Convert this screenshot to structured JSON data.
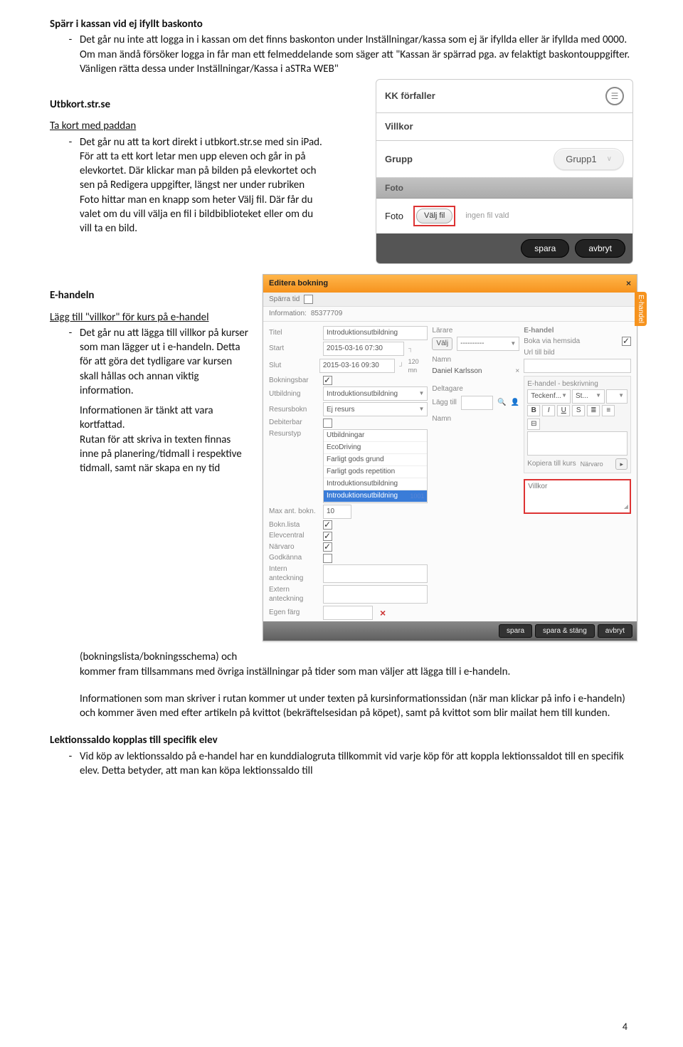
{
  "doc": {
    "section1": {
      "title": "Spärr i kassan vid ej ifyllt baskonto",
      "body": "Det går nu inte att logga in i kassan om det finns baskonton under Inställningar/kassa som ej är ifyllda eller är ifyllda med 0000.\nOm man ändå försöker logga in får man ett felmeddelande som säger att \"Kassan är spärrad pga. av felaktigt baskontouppgifter. Vänligen rätta dessa under Inställningar/Kassa i aSTRa WEB\""
    },
    "section2": {
      "title": "Utbkort.str.se",
      "sub": "Ta kort med paddan",
      "body": "Det går nu att ta kort direkt i utbkort.str.se med sin iPad. För att ta ett kort letar men upp eleven och går in på elevkortet. Där klickar man på bilden på elevkortet och sen på Redigera uppgifter, längst ner under rubriken Foto hittar man en knapp som heter Välj fil. Där får du valet om du vill välja en fil i bildbiblioteket eller om du vill ta en bild."
    },
    "section3": {
      "title": "E-handeln",
      "sub1": "Lägg till \"villkor\" för kurs på e-handel",
      "body1": "Det går nu att lägga till villkor på kurser som man lägger ut i e-handeln. Detta för att göra det tydligare var kursen skall hållas och annan viktig information.",
      "body2": "Informationen är tänkt att vara kortfattad.\nRutan för att skriva in texten finnas inne på planering/tidmall i respektive tidmall, samt när skapa en ny tid (bokningslista/bokningsschema) och kommer fram tillsammans med övriga inställningar på tider som man väljer att lägga till i e-handeln.",
      "body3": "Informationen som man skriver i rutan kommer ut under texten på kursinformationssidan (när man klickar på info i e-handeln) och kommer även med efter artikeln på kvittot (bekräftelsesidan på köpet), samt på kvittot som blir mailat hem till kunden.",
      "sub2": "Lektionssaldo kopplas till specifik elev",
      "body4": "Vid köp av lektionssaldo på e-handel har en kunddialogruta tillkommit vid varje köp för att koppla lektionssaldot till en specifik elev. Detta betyder, att man kan köpa lektionssaldo till"
    },
    "page_number": "4"
  },
  "ipad": {
    "row1_label": "KK förfaller",
    "row2_label": "Villkor",
    "row3_label": "Grupp",
    "row3_value": "Grupp1",
    "foto_header": "Foto",
    "foto_label": "Foto",
    "valj_fil": "Välj fil",
    "ingen_fil": "ingen fil vald",
    "spara": "spara",
    "avbryt": "avbryt"
  },
  "book": {
    "title": "Editera bokning",
    "sparra": "Spärra tid",
    "info_label": "Information:",
    "info_id": "85377709",
    "ehandel_tab": "E-handel",
    "col1": {
      "titel_l": "Titel",
      "titel_v": "Introduktionsutbildning",
      "start_l": "Start",
      "start_v": "2015-03-16  07:30",
      "slut_l": "Slut",
      "slut_v": "2015-03-16  09:30",
      "min_suffix": "120  mn",
      "bok_l": "Bokningsbar",
      "utb_l": "Utbildning",
      "utb_v": "Introduktionsutbildning",
      "reb_l": "Resursbokn",
      "reb_v": "Ej resurs",
      "deb_l": "Debiterbar",
      "res_l": "Resurstyp",
      "res_items": [
        "Utbildningar",
        "EcoDriving",
        "Farligt gods grund",
        "Farligt gods repetition",
        "Introduktionsutbildning",
        "Introduktionsutbildning"
      ],
      "res_code": "1001",
      "max_l": "Max ant. bokn.",
      "max_v": "10",
      "blist_l": "Bokn.lista",
      "elev_l": "Elevcentral",
      "narv_l": "Närvaro",
      "god_l": "Godkänna",
      "int_l": "Intern anteckning",
      "ext_l": "Extern anteckning",
      "egf_l": "Egen färg"
    },
    "col2": {
      "larare_l": "Lärare",
      "valj": "Välj",
      "namn_l": "Namn",
      "namn_v": "Daniel Karlsson",
      "delt_l": "Deltagare",
      "lagg_l": "Lägg till"
    },
    "col3": {
      "eh_head": "E-handel",
      "boka_l": "Boka via hemsida",
      "url_l": "Url till bild",
      "besk_l": "E-handel - beskrivning",
      "tecken": "Teckenf...",
      "st": "St...",
      "kopiera_l": "Kopiera till kurs",
      "narvaro": "Närvaro",
      "villkor": "Villkor"
    },
    "footer": {
      "spara": "spara",
      "sparastang": "spara & stäng",
      "avbryt": "avbryt"
    }
  }
}
